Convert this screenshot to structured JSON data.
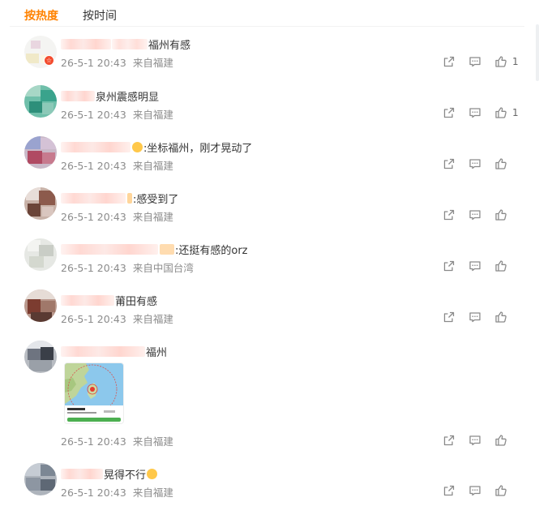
{
  "tabs": {
    "hot": "按热度",
    "time": "按时间"
  },
  "comments": [
    {
      "text": "福州有感",
      "date": "26-5-1 20:43",
      "location": "来自福建",
      "likes": "1",
      "badge": "☆"
    },
    {
      "text": "泉州震感明显",
      "date": "26-5-1 20:43",
      "location": "来自福建",
      "likes": "1"
    },
    {
      "text": ":坐标福州，刚才晃动了",
      "date": "26-5-1 20:43",
      "location": "来自福建",
      "likes": ""
    },
    {
      "text": ":感受到了",
      "date": "26-5-1 20:43",
      "location": "来自福建",
      "likes": ""
    },
    {
      "text": ":还挺有感的orz",
      "date": "26-5-1 20:43",
      "location": "来自中国台湾",
      "likes": ""
    },
    {
      "text": "莆田有感",
      "date": "26-5-1 20:43",
      "location": "来自福建",
      "likes": ""
    },
    {
      "text": "福州",
      "date": "26-5-1 20:43",
      "location": "来自福建",
      "likes": ""
    },
    {
      "text": "晃得不行",
      "date": "26-5-1 20:43",
      "location": "来自福建",
      "likes": ""
    }
  ],
  "icons": {
    "share": "share-icon",
    "comment": "comment-icon",
    "like": "thumbs-up-icon"
  },
  "colors": {
    "active_tab": "#ff8200",
    "meta_text": "#8c8c8c",
    "icon": "#8a8a8a"
  }
}
